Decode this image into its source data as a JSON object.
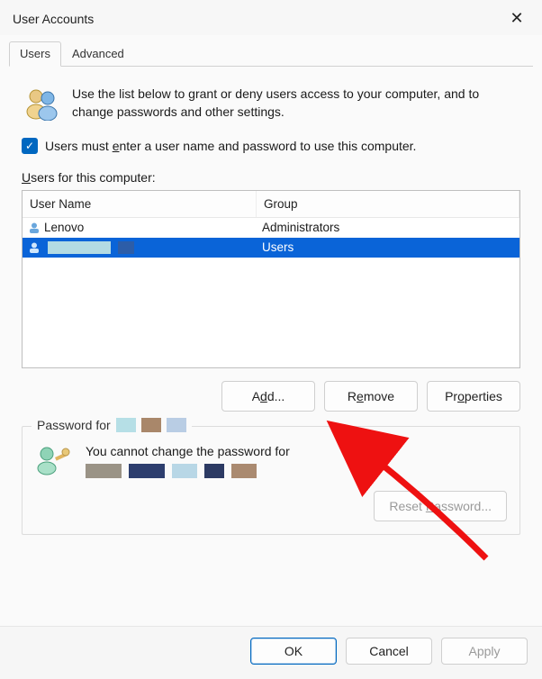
{
  "window": {
    "title": "User Accounts"
  },
  "tabs": [
    {
      "label": "Users",
      "active": true
    },
    {
      "label": "Advanced",
      "active": false
    }
  ],
  "intro": "Use the list below to grant or deny users access to your computer, and to change passwords and other settings.",
  "checkbox": {
    "checked": true,
    "prefix": "Users must ",
    "ulchar": "e",
    "rest": "nter a user name and password to use this computer."
  },
  "users_label": {
    "ulchar": "U",
    "rest": "sers for this computer:"
  },
  "columns": {
    "user": "User Name",
    "group": "Group"
  },
  "rows": [
    {
      "user": "Lenovo",
      "group": "Administrators",
      "selected": false
    },
    {
      "user": "",
      "group": "Users",
      "selected": true
    }
  ],
  "buttons": {
    "add": "Add...",
    "remove_pre": "R",
    "remove_ul": "e",
    "remove_post": "move",
    "props_pre": "Pr",
    "props_ul": "o",
    "props_post": "perties"
  },
  "password_group": {
    "legend_prefix": "Password for",
    "cannot_change": "You cannot change the password for",
    "reset_pre": "Reset ",
    "reset_ul": "P",
    "reset_post": "assword..."
  },
  "bottom": {
    "ok": "OK",
    "cancel": "Cancel",
    "apply": "Apply"
  },
  "swatches": {
    "legend": [
      "#b6dfe6",
      "#a9876a",
      "#b9cde4"
    ],
    "line": [
      "#9a9386",
      "#2d3e6e",
      "#b8d7e6",
      "#2c3a63",
      "#aa8a70"
    ]
  }
}
